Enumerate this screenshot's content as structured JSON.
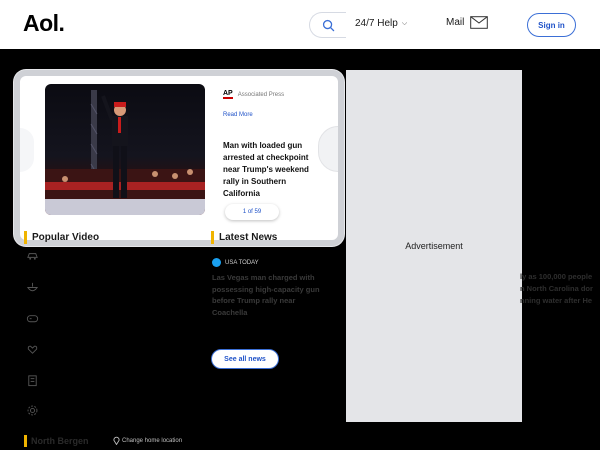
{
  "header": {
    "logo": "Aol.",
    "help_label": "24/7 Help",
    "mail_label": "Mail",
    "signin_label": "Sign in"
  },
  "left_rail": {
    "icons": [
      "star-icon",
      "piggy-bank-icon",
      "trend-chart-icon",
      "tv-icon",
      "clapperboard-icon",
      "car-icon",
      "food-icon",
      "gamepad-icon",
      "heart-hands-icon",
      "building-icon",
      "settings-icon"
    ]
  },
  "featured": {
    "source": "Associated Press",
    "source_logo": "AP",
    "read_more": "Read More",
    "headline": "Man with loaded gun arrested at checkpoint near Trump's weekend rally in Southern California",
    "pager": "1 of 59"
  },
  "sections": {
    "popular_video": "Popular Video",
    "latest_news": "Latest News"
  },
  "latest_news": {
    "source": "USA TODAY",
    "headline": "Las Vegas man charged with possessing high-capacity gun before Trump rally near Coachella",
    "see_all": "See all news"
  },
  "ad": {
    "label": "Advertisement"
  },
  "bleed_lines": [
    "ly as 100,000 people",
    "n North Carolina dor",
    "nning water after He"
  ],
  "location": {
    "title": "North Bergen",
    "change": "Change home location"
  },
  "colors": {
    "accent_blue": "#1f52c8",
    "section_bar": "#f0b400",
    "ad_bg": "#e4e5e8"
  }
}
